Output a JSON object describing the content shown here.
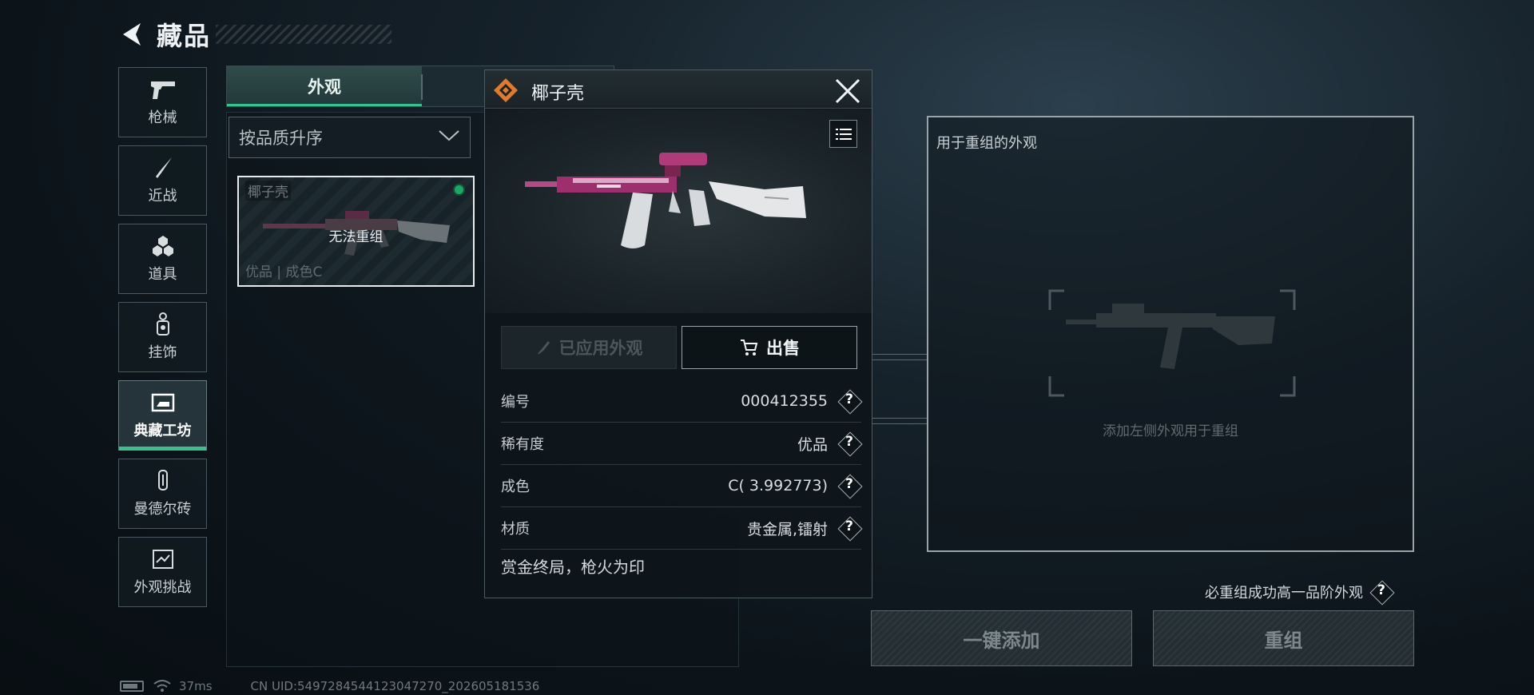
{
  "header": {
    "title": "藏品"
  },
  "sidebar": {
    "items": [
      {
        "label": "枪械",
        "icon": "pistol-icon"
      },
      {
        "label": "近战",
        "icon": "knife-icon"
      },
      {
        "label": "道具",
        "icon": "grenade-icon"
      },
      {
        "label": "挂饰",
        "icon": "charm-icon"
      },
      {
        "label": "典藏工坊",
        "icon": "workshop-icon",
        "active": true
      },
      {
        "label": "曼德尔砖",
        "icon": "brick-icon"
      },
      {
        "label": "外观挑战",
        "icon": "challenge-icon"
      }
    ]
  },
  "tabs": {
    "appearance": "外观"
  },
  "sort": {
    "selected": "按品质升序"
  },
  "item_card": {
    "name": "椰子壳",
    "status": "无法重组",
    "meta": "优品 | 成色C"
  },
  "detail": {
    "title": "椰子壳",
    "applied_label": "已应用外观",
    "sell_label": "出售",
    "attributes": [
      {
        "label": "编号",
        "value": "000412355"
      },
      {
        "label": "稀有度",
        "value": "优品"
      },
      {
        "label": "成色",
        "value": "C( 3.992773)"
      },
      {
        "label": "材质",
        "value": "贵金属,镭射"
      }
    ],
    "description": "赏金终局，枪火为印"
  },
  "recombine": {
    "panel_title": "用于重组的外观",
    "hint": "添加左侧外观用于重组",
    "guarantee": "必重组成功高一品阶外观",
    "add_all_label": "一键添加",
    "recombine_label": "重组"
  },
  "status_bar": {
    "ping": "37ms",
    "uid": "CN UID:5497284544123047270_202605181536"
  },
  "colors": {
    "accent": "#35c28d",
    "emblem": "#e07a2c",
    "skin_pink": "#c2307a"
  }
}
